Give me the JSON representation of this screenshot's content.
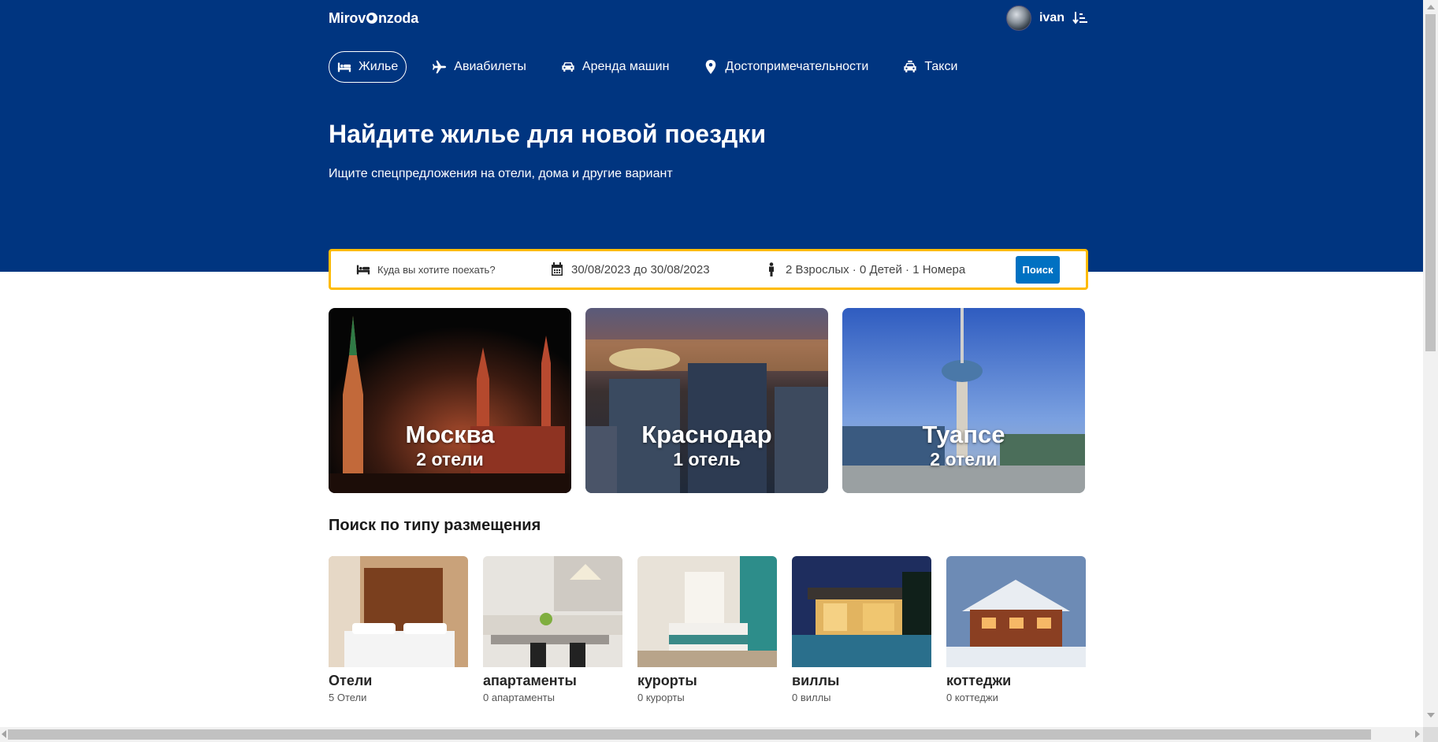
{
  "header": {
    "logo_before": "Mirov",
    "logo_after": "nzoda",
    "username": "ivan"
  },
  "nav": [
    {
      "label": "Жилье",
      "icon": "bed-icon",
      "active": true
    },
    {
      "label": "Авиабилеты",
      "icon": "plane-icon",
      "active": false
    },
    {
      "label": "Аренда машин",
      "icon": "car-icon",
      "active": false
    },
    {
      "label": "Достопримечательности",
      "icon": "map-pin-icon",
      "active": false
    },
    {
      "label": "Такси",
      "icon": "taxi-icon",
      "active": false
    }
  ],
  "hero": {
    "title": "Найдите жилье для новой поездки",
    "subtitle": "Ищите спецпредложения на отели, дома и другие вариант"
  },
  "search": {
    "destination_placeholder": "Куда вы хотите поехать?",
    "dates": "30/08/2023 до 30/08/2023",
    "guests": "2 Взрослых · 0 Детей · 1 Номера",
    "button_label": "Поиск"
  },
  "cities": [
    {
      "name": "Москва",
      "count": "2 отели"
    },
    {
      "name": "Краснодар",
      "count": "1 отель"
    },
    {
      "name": "Туапсе",
      "count": "2 отели"
    }
  ],
  "property_types": {
    "title": "Поиск по типу размещения",
    "items": [
      {
        "name": "Отели",
        "count": "5 Отели"
      },
      {
        "name": "апартаменты",
        "count": "0 апартаменты"
      },
      {
        "name": "курорты",
        "count": "0 курорты"
      },
      {
        "name": "виллы",
        "count": "0 виллы"
      },
      {
        "name": "коттеджи",
        "count": "0 коттеджи"
      }
    ]
  },
  "colors": {
    "brand_blue": "#003580",
    "search_border": "#febb02",
    "button_blue": "#0071c2"
  }
}
